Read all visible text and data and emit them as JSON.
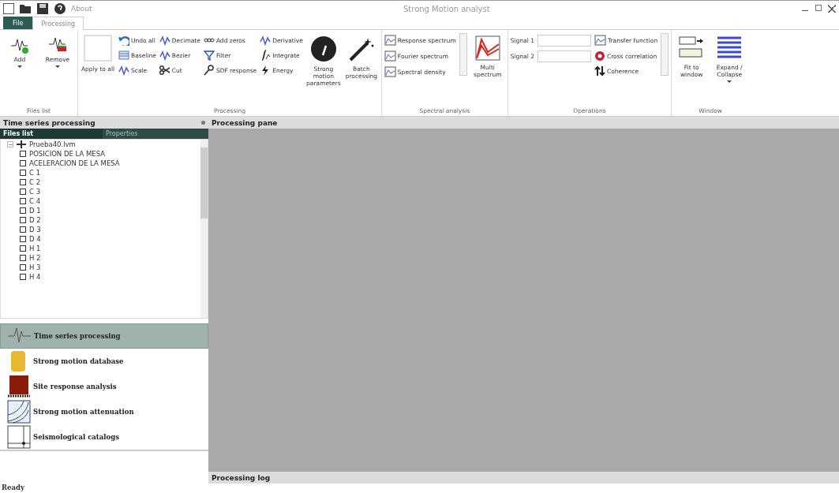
{
  "window": {
    "title": "Strong Motion analyst",
    "quick_access": [
      {
        "kind": "button"
      },
      {
        "kind": "button"
      },
      {
        "kind": "button"
      }
    ],
    "about": "About"
  },
  "tabs": [
    {
      "label": "File",
      "kind": "file",
      "selected": false
    },
    {
      "label": "Processing",
      "kind": "tab",
      "selected": true
    }
  ],
  "ribbon": [
    {
      "label": "Files list",
      "items": [
        {
          "kind": "large",
          "label": "Add",
          "dropdown": true
        },
        {
          "kind": "large",
          "label": "Remove",
          "dropdown": true
        }
      ]
    },
    {
      "label": "Processing",
      "items": [
        {
          "kind": "large",
          "label": "Apply to all",
          "dropdown": false
        },
        {
          "kind": "column",
          "buttons": [
            {
              "label": "Undo all"
            },
            {
              "label": "Baseline"
            },
            {
              "label": "Scale"
            }
          ]
        },
        {
          "kind": "column",
          "buttons": [
            {
              "label": "Decimate"
            },
            {
              "label": "Bezier"
            },
            {
              "label": "Cut"
            }
          ]
        },
        {
          "kind": "column",
          "buttons": [
            {
              "label": "Add zeros"
            },
            {
              "label": "Filter"
            },
            {
              "label": "SDF response"
            }
          ]
        },
        {
          "kind": "column",
          "buttons": [
            {
              "label": "Derivative"
            },
            {
              "label": "Integrate"
            },
            {
              "label": "Energy"
            }
          ]
        },
        {
          "kind": "large",
          "label": "Strong motion parameters",
          "dropdown": false
        },
        {
          "kind": "large",
          "label": "Batch processing",
          "dropdown": false
        }
      ]
    },
    {
      "label": "Spectral analysis",
      "items": [
        {
          "kind": "column",
          "buttons": [
            {
              "label": "Response spectrum"
            },
            {
              "label": "Fourier spectrum"
            },
            {
              "label": "Spectral density"
            }
          ]
        },
        {
          "kind": "scroller"
        },
        {
          "kind": "large",
          "label": "Multi spectrum",
          "dropdown": false
        }
      ]
    },
    {
      "label": "Operations",
      "items": [
        {
          "kind": "fields",
          "fields": [
            {
              "label": "Signal 1"
            },
            {
              "label": "Signal 2"
            }
          ]
        },
        {
          "kind": "column",
          "buttons": [
            {
              "label": "Transfer function"
            },
            {
              "label": "Cross correlation"
            },
            {
              "label": "Coherence"
            }
          ]
        },
        {
          "kind": "scroller"
        }
      ]
    },
    {
      "label": "Window",
      "items": [
        {
          "kind": "large",
          "label": "Fit to window",
          "dropdown": false
        },
        {
          "kind": "large",
          "label": "Expand / Collapse",
          "dropdown": true
        }
      ]
    }
  ],
  "left_panel": {
    "title": "Time series processing",
    "pane_tabs": [
      {
        "label": "Files list",
        "selected": true
      },
      {
        "label": "Properties",
        "selected": false
      }
    ],
    "tree": [
      {
        "label": "Prueba40.lvm",
        "expanded": true,
        "children": [
          {
            "label": "POSICION DE LA MESA"
          },
          {
            "label": "ACELERACION DE LA  MESA"
          },
          {
            "label": "C 1"
          },
          {
            "label": "C 2"
          },
          {
            "label": "C 3"
          },
          {
            "label": "C 4"
          },
          {
            "label": "D 1"
          },
          {
            "label": "D 2"
          },
          {
            "label": "D 3"
          },
          {
            "label": "D 4"
          },
          {
            "label": "H 1"
          },
          {
            "label": "H 2"
          },
          {
            "label": "H 3"
          },
          {
            "label": "H 4"
          }
        ]
      }
    ],
    "modules": [
      {
        "label": "Time series processing",
        "selected": true
      },
      {
        "label": "Strong motion database",
        "selected": false
      },
      {
        "label": "Site response analysis",
        "selected": false
      },
      {
        "label": "Strong motion attenuation",
        "selected": false
      },
      {
        "label": "Seismological catalogs",
        "selected": false
      }
    ]
  },
  "main": {
    "title": "Processing pane",
    "log_title": "Processing log"
  },
  "status_bar": {
    "text": "Ready"
  }
}
